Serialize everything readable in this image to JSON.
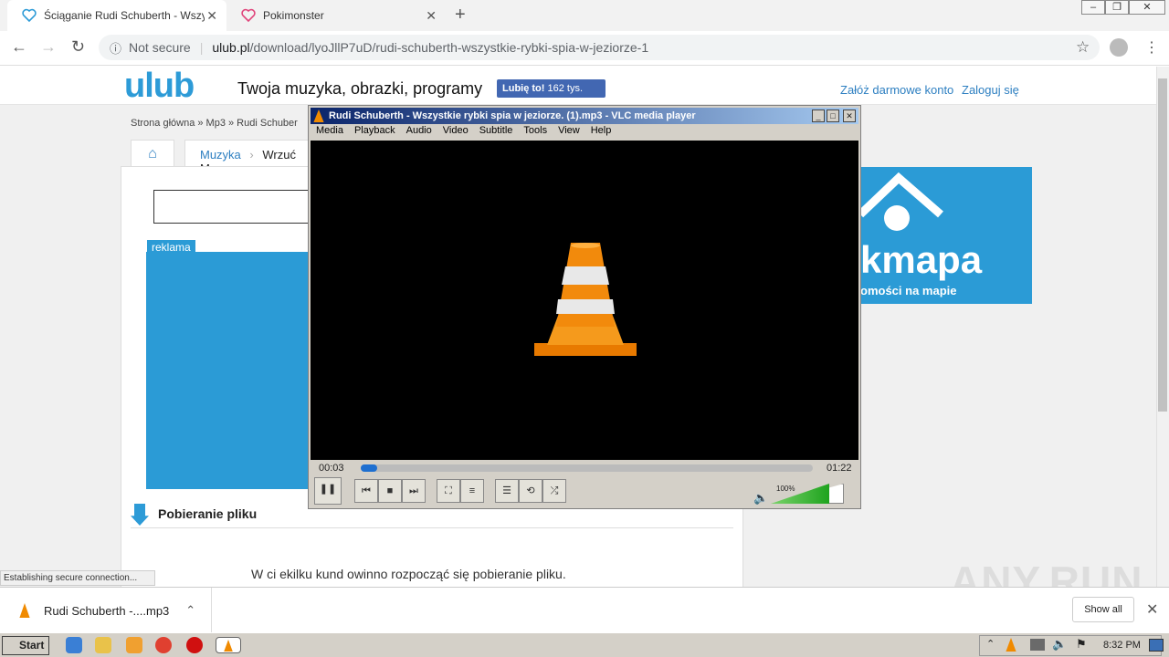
{
  "browser": {
    "tabs": [
      {
        "title": "Ściąganie Rudi Schuberth - Wszystkie",
        "active": true,
        "icon": "ulub-heart-icon"
      },
      {
        "title": "Pokimonster",
        "active": false,
        "icon": "pokimonster-heart-icon"
      }
    ],
    "security_label": "Not secure",
    "url_host": "ulub.pl",
    "url_path": "/download/lyoJllP7uD/rudi-schuberth-wszystkie-rybki-spia-w-jeziorze-1",
    "status_text": "Establishing secure connection..."
  },
  "site": {
    "logo": "ulub",
    "tagline": "Twoja muzyka, obrazki, programy",
    "like_label": "Lubię to!",
    "like_count": "162 tys.",
    "register": "Załóż darmowe konto",
    "login": "Zaloguj się",
    "breadcrumbs": "Strona główna » Mp3 » Rudi Schuber",
    "nav_music": "Muzyka",
    "nav_upload": "Wrzuć M",
    "ad_label": "reklama",
    "download_heading": "Pobieranie pliku",
    "download_text": "W ci    ekilku       kund       owinno rozpocząć się pobieranie pliku.",
    "ad_brand": "kmapa",
    "ad_subtitle": "omości na mapie"
  },
  "vlc": {
    "title": "Rudi Schuberth  -  Wszystkie rybki spia w jeziorze. (1).mp3 - VLC media player",
    "menu": [
      "Media",
      "Playback",
      "Audio",
      "Video",
      "Subtitle",
      "Tools",
      "View",
      "Help"
    ],
    "elapsed": "00:03",
    "total": "01:22",
    "progress": 0.036,
    "volume_label": "100%",
    "volume": 0.8
  },
  "download_bar": {
    "filename": "Rudi Schuberth  -....mp3",
    "show_all": "Show all"
  },
  "watermark": "ANY.RUN",
  "taskbar": {
    "start": "Start",
    "clock": "8:32 PM"
  }
}
